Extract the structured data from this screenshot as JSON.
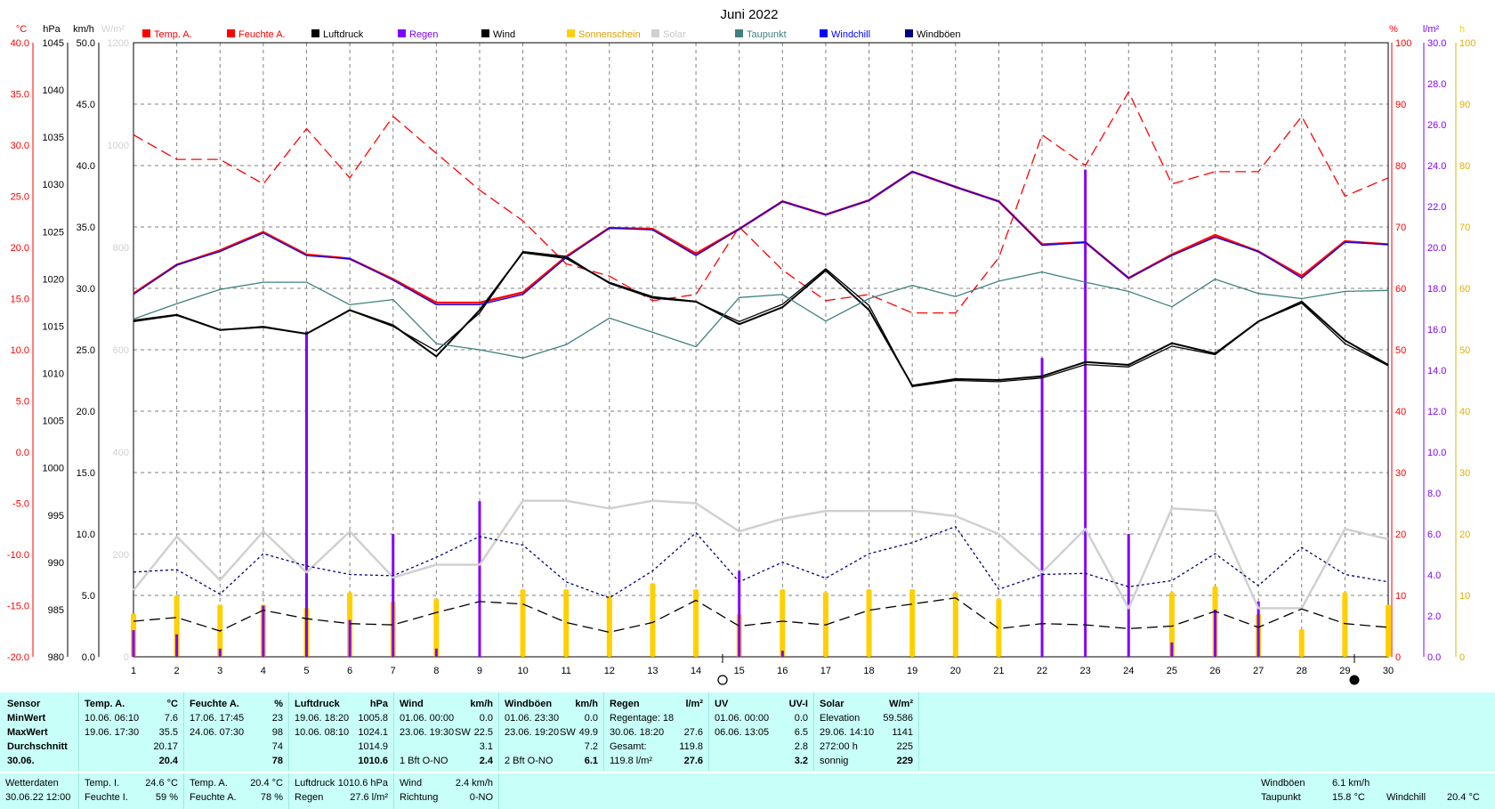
{
  "title": "Juni 2022",
  "colors": {
    "temp": "#ff0000",
    "feuchte": "#ff0000",
    "luftdruck": "#000000",
    "regen": "#8000ff",
    "wind": "#000000",
    "sonnenschein": "#ffd000",
    "solar": "#d0d0d0",
    "taupunkt": "#408080",
    "windchill": "#0000ff",
    "windboeen": "#000080",
    "grid": "#808080",
    "panel": "#c8fff8"
  },
  "axis_units": {
    "temp": "°C",
    "pressure": "hPa",
    "wind": "km/h",
    "solar": "W/m²",
    "humidity": "%",
    "rain": "l/m²",
    "sun": "h"
  },
  "chart_data": {
    "type": "line",
    "title": "Juni 2022",
    "x": [
      1,
      2,
      3,
      4,
      5,
      6,
      7,
      8,
      9,
      10,
      11,
      12,
      13,
      14,
      15,
      16,
      17,
      18,
      19,
      20,
      21,
      22,
      23,
      24,
      25,
      26,
      27,
      28,
      29,
      30
    ],
    "x_ticks": [
      "1",
      "2",
      "3",
      "4",
      "5",
      "6",
      "7",
      "8",
      "9",
      "10",
      "11",
      "12",
      "13",
      "14",
      "15",
      "16",
      "17",
      "18",
      "19",
      "20",
      "21",
      "22",
      "23",
      "24",
      "25",
      "26",
      "27",
      "28",
      "29",
      "30"
    ],
    "axes": {
      "temp_c": {
        "ylim": [
          -20,
          40
        ],
        "ticks": [
          "40.0",
          "35.0",
          "30.0",
          "25.0",
          "20.0",
          "15.0",
          "10.0",
          "5.0",
          "0.0",
          "-5.0",
          "-10.0",
          "-15.0",
          "-20.0"
        ]
      },
      "pressure_hpa": {
        "ylim": [
          980,
          1045
        ],
        "ticks": [
          "1045",
          "1040",
          "1035",
          "1030",
          "1025",
          "1020",
          "1015",
          "1010",
          "1005",
          "1000",
          "995",
          "990",
          "985",
          "980"
        ]
      },
      "wind_kmh": {
        "ylim": [
          0,
          50
        ],
        "ticks": [
          "50.0",
          "45.0",
          "40.0",
          "35.0",
          "30.0",
          "25.0",
          "20.0",
          "15.0",
          "10.0",
          "5.0",
          "0.0"
        ]
      },
      "solar_wm2": {
        "ylim": [
          0,
          1200
        ],
        "ticks": [
          "1200",
          "1000",
          "800",
          "600",
          "400",
          "200",
          "0"
        ]
      },
      "humidity_pct": {
        "ylim": [
          0,
          100
        ],
        "ticks": [
          "100",
          "90",
          "80",
          "70",
          "60",
          "50",
          "40",
          "30",
          "20",
          "10",
          "0"
        ]
      },
      "rain_lm2": {
        "ylim": [
          0,
          30
        ],
        "ticks": [
          "30.0",
          "28.0",
          "26.0",
          "24.0",
          "22.0",
          "20.0",
          "18.0",
          "16.0",
          "14.0",
          "12.0",
          "10.0",
          "8.0",
          "6.0",
          "4.0",
          "2.0",
          "0.0"
        ]
      },
      "sun_h": {
        "ylim": [
          0,
          100
        ],
        "ticks": [
          "100",
          "90",
          "80",
          "70",
          "60",
          "50",
          "40",
          "30",
          "20",
          "10",
          "0"
        ]
      }
    },
    "legend": [
      "Temp. A.",
      "Feuchte A.",
      "Luftdruck",
      "Regen",
      "Wind",
      "Sonnenschein",
      "Solar",
      "Taupunkt",
      "Windchill",
      "Windböen"
    ],
    "legend_placement": "top",
    "grid": true,
    "series": [
      {
        "name": "Temp. A.",
        "axis": "temp_c",
        "style": "solid",
        "color": "#ff0000",
        "values": [
          15.5,
          18.3,
          19.7,
          21.5,
          19.3,
          18.9,
          16.9,
          14.6,
          14.6,
          15.6,
          19.1,
          21.9,
          21.8,
          19.4,
          21.8,
          24.5,
          23.2,
          24.6,
          27.4,
          25.9,
          24.5,
          20.3,
          20.5,
          17.0,
          19.3,
          21.2,
          19.6,
          17.2,
          20.6,
          20.3
        ]
      },
      {
        "name": "Feuchte A.",
        "axis": "humidity_pct",
        "style": "dashed",
        "color": "#ff0000",
        "values": [
          85,
          81,
          81,
          77,
          86,
          78,
          88,
          82,
          76,
          71,
          64,
          62,
          58,
          59,
          70,
          63,
          58,
          59,
          56,
          56,
          65,
          85,
          80,
          92,
          77,
          79,
          79,
          88,
          75,
          78
        ]
      },
      {
        "name": "Luftdruck",
        "axis": "pressure_hpa",
        "style": "solid",
        "color": "#000000",
        "values": [
          1015.6,
          1016.2,
          1014.6,
          1014.9,
          1014.2,
          1016.7,
          1015.1,
          1011.8,
          1016.7,
          1022.8,
          1022.2,
          1019.6,
          1018.1,
          1017.6,
          1015.2,
          1017.0,
          1020.9,
          1016.7,
          1008.7,
          1009.4,
          1009.3,
          1009.7,
          1011.2,
          1010.9,
          1013.2,
          1012.1,
          1015.5,
          1017.6,
          1013.5,
          1010.9
        ]
      },
      {
        "name": "Wind",
        "axis": "wind_kmh",
        "style": "solid",
        "color": "#000000",
        "values": [
          27.3,
          27.8,
          26.6,
          26.9,
          26.3,
          28.2,
          26.9,
          24.9,
          28.0,
          33.0,
          32.6,
          30.4,
          29.2,
          28.9,
          27.3,
          28.7,
          31.6,
          28.6,
          22.0,
          22.5,
          22.4,
          22.7,
          23.8,
          23.6,
          25.3,
          24.6,
          27.3,
          28.8,
          25.5,
          23.7
        ]
      },
      {
        "name": "Taupunkt",
        "axis": "temp_c",
        "style": "solid",
        "color": "#408080",
        "values": [
          13.0,
          14.5,
          15.9,
          16.6,
          16.6,
          14.4,
          14.9,
          10.6,
          10.0,
          9.2,
          10.5,
          13.1,
          11.7,
          10.3,
          15.1,
          15.4,
          12.8,
          15.0,
          16.3,
          15.2,
          16.7,
          17.6,
          16.6,
          15.7,
          14.2,
          16.9,
          15.5,
          15.0,
          15.7,
          15.8
        ]
      },
      {
        "name": "Windchill",
        "axis": "temp_c",
        "style": "solid",
        "color": "#0000ff",
        "values": [
          15.4,
          18.3,
          19.6,
          21.4,
          19.2,
          18.9,
          16.8,
          14.4,
          14.4,
          15.4,
          19.0,
          21.9,
          21.7,
          19.2,
          21.8,
          24.5,
          23.2,
          24.6,
          27.4,
          25.9,
          24.5,
          20.2,
          20.5,
          17.0,
          19.2,
          21.0,
          19.6,
          17.0,
          20.5,
          20.3
        ]
      },
      {
        "name": "Solar",
        "axis": "solar_wm2",
        "style": "solid",
        "color": "#d0d0d0",
        "values": [
          130,
          235,
          150,
          245,
          165,
          245,
          155,
          180,
          180,
          305,
          305,
          290,
          305,
          300,
          245,
          270,
          285,
          285,
          285,
          275,
          240,
          165,
          250,
          95,
          290,
          285,
          95,
          95,
          250,
          230
        ]
      },
      {
        "name": "Windböen",
        "axis": "wind_kmh",
        "style": "dotted",
        "color": "#000080",
        "values": [
          6.9,
          7.1,
          5.1,
          8.4,
          7.4,
          6.7,
          6.6,
          8.1,
          9.8,
          9.1,
          6.1,
          4.8,
          7.0,
          10.1,
          6.1,
          7.7,
          6.4,
          8.4,
          9.3,
          10.6,
          5.5,
          6.7,
          6.8,
          5.7,
          6.2,
          8.4,
          5.8,
          8.9,
          6.7,
          6.1
        ]
      },
      {
        "name": "Luftdruck-Tag",
        "axis": "wind_kmh",
        "style": "dashed",
        "color": "#000000",
        "values": [
          2.9,
          3.2,
          2.1,
          3.8,
          3.1,
          2.7,
          2.6,
          3.6,
          4.5,
          4.3,
          2.8,
          2.0,
          2.8,
          4.6,
          2.5,
          2.9,
          2.6,
          3.8,
          4.3,
          4.8,
          2.3,
          2.7,
          2.6,
          2.3,
          2.5,
          3.7,
          2.4,
          3.9,
          2.7,
          2.4
        ]
      }
    ],
    "bars": [
      {
        "name": "Sonnenschein",
        "axis": "sun_h",
        "color": "#ffd000",
        "values": [
          7,
          10,
          8.5,
          8.5,
          8,
          10.5,
          9,
          9.5,
          0,
          11,
          11,
          10,
          12,
          11,
          7,
          11,
          10.5,
          11,
          11,
          10.5,
          9.5,
          0,
          0,
          0,
          10.5,
          11.5,
          7,
          4.5,
          10.5,
          8.5
        ]
      },
      {
        "name": "Regen",
        "axis": "rain_lm2",
        "color": "#8000ff",
        "values": [
          1.3,
          1.1,
          0.4,
          2.5,
          15.9,
          1.8,
          6.0,
          0.4,
          7.6,
          0,
          0,
          0,
          0,
          0,
          4.2,
          0.3,
          0,
          0,
          0,
          0,
          0,
          14.6,
          23.8,
          6.0,
          0.7,
          2.3,
          2.7,
          0,
          0,
          0
        ]
      }
    ]
  },
  "table": {
    "sensor": {
      "header": "Sensor",
      "rows": [
        "MinWert",
        "MaxWert",
        "Durchschnitt",
        "30.06."
      ]
    },
    "temp": {
      "header": "Temp. A.",
      "unit": "°C",
      "min_dt": "10.06.  06:10",
      "min_v": "7.6",
      "max_dt": "19.06.  17:30",
      "max_v": "35.5",
      "avg": "20.17",
      "day": "20.4"
    },
    "feuchte": {
      "header": "Feuchte A.",
      "unit": "%",
      "min_dt": "17.06.  17:45",
      "min_v": "23",
      "max_dt": "24.06.  07:30",
      "max_v": "98",
      "avg": "74",
      "day": "78"
    },
    "luftdruck": {
      "header": "Luftdruck",
      "unit": "hPa",
      "min_dt": "19.06.  18:20",
      "min_v": "1005.8",
      "max_dt": "10.06.  08:10",
      "max_v": "1024.1",
      "avg": "1014.9",
      "day": "1010.6"
    },
    "wind": {
      "header": "Wind",
      "unit": "km/h",
      "min_dt": "01.06.  00:00",
      "min_v": "0.0",
      "max_dt": "23.06.  19:30",
      "max_dir": "SW",
      "max_v": "22.5",
      "avg": "3.1",
      "day_label": "1 Bft O-NO",
      "day": "2.4"
    },
    "boeen": {
      "header": "Windböen",
      "unit": "km/h",
      "min_dt": "01.06.  23:30",
      "min_v": "0.0",
      "max_dt": "23.06.  19:20",
      "max_dir": "SW",
      "max_v": "49.9",
      "avg": "7.2",
      "day_label": "2 Bft O-NO",
      "day": "6.1"
    },
    "regen": {
      "header": "Regen",
      "unit": "l/m²",
      "r1_label": "Regentage: 18",
      "r1_v": "",
      "r2_label": "30.06.  18:20",
      "r2_v": "27.6",
      "r3_label": "Gesamt:",
      "r3_v": "119.8",
      "day_label": "119.8 l/m²",
      "day": "27.6"
    },
    "uv": {
      "header": "UV",
      "unit": "UV-I",
      "min_dt": "01.06.  00:00",
      "min_v": "0.0",
      "max_dt": "06.06.  13:05",
      "max_v": "6.5",
      "avg": "2.8",
      "day": "3.2"
    },
    "solar": {
      "header": "Solar",
      "unit": "W/m²",
      "r1_label": "Elevation",
      "r1_v": "59.586",
      "r2_label": "29.06.  14:10",
      "r2_v": "1141",
      "r3_label": "272:00 h",
      "r3_v": "225",
      "day_label": "sonnig",
      "day": "229"
    }
  },
  "footer": {
    "wetterdaten": "Wetterdaten",
    "datetime": "30.06.22 12:00",
    "temp_i_label": "Temp. I.",
    "temp_i": "24.6 °C",
    "feuchte_i_label": "Feuchte I.",
    "feuchte_i": "59 %",
    "temp_a_label": "Temp. A.",
    "temp_a": "20.4 °C",
    "feuchte_a_label": "Feuchte A.",
    "feuchte_a": "78 %",
    "luftdruck_label": "Luftdruck",
    "luftdruck": "1010.6 hPa",
    "regen_label": "Regen",
    "regen": "27.6 l/m²",
    "wind_label": "Wind",
    "wind": "2.4 km/h",
    "richtung_label": "Richtung",
    "richtung": "0-NO",
    "boeen_label": "Windböen",
    "boeen": "6.1 km/h",
    "taupunkt_label": "Taupunkt",
    "taupunkt": "15.8 °C",
    "windchill_label": "Windchill",
    "windchill": "20.4 °C"
  }
}
